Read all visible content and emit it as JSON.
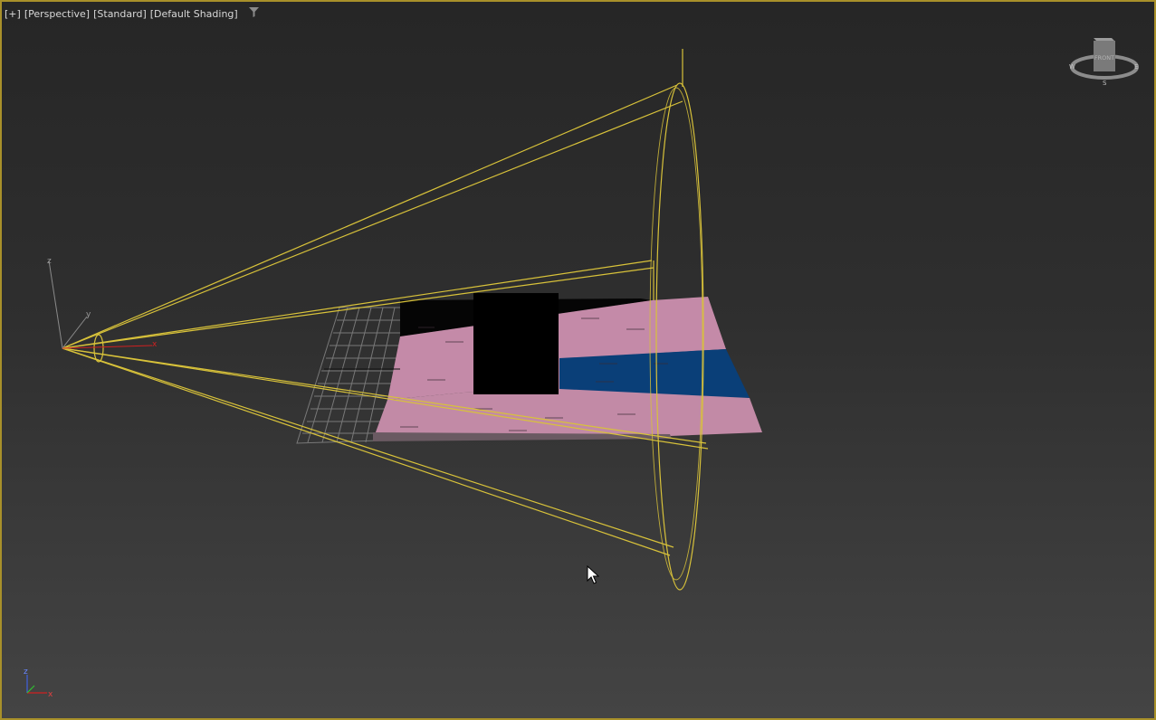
{
  "viewport": {
    "labels": [
      "[+]",
      "[Perspective]",
      "[Standard]",
      "[Default Shading]"
    ],
    "filter_icon": "filter-funnel-icon",
    "border_color": "#a8902a"
  },
  "viewcube": {
    "face": "FRONT",
    "compass": {
      "left": "W",
      "right": "E",
      "bottom": "S"
    }
  },
  "axis_tripod": {
    "x": "x",
    "y": "y",
    "z": "z"
  },
  "gizmo_axes": {
    "x": "x",
    "y": "y",
    "z": "z"
  },
  "colors": {
    "light_cone": "#d8c23a",
    "plane_pink": "#c38aa8",
    "plane_blue": "#0a3f78",
    "box": "#000000",
    "grid": "#8a8a8a",
    "axis_x": "#d02020",
    "axis_y": "#30c030",
    "axis_z": "#4060e0"
  },
  "cursor": "arrow-cursor-icon"
}
